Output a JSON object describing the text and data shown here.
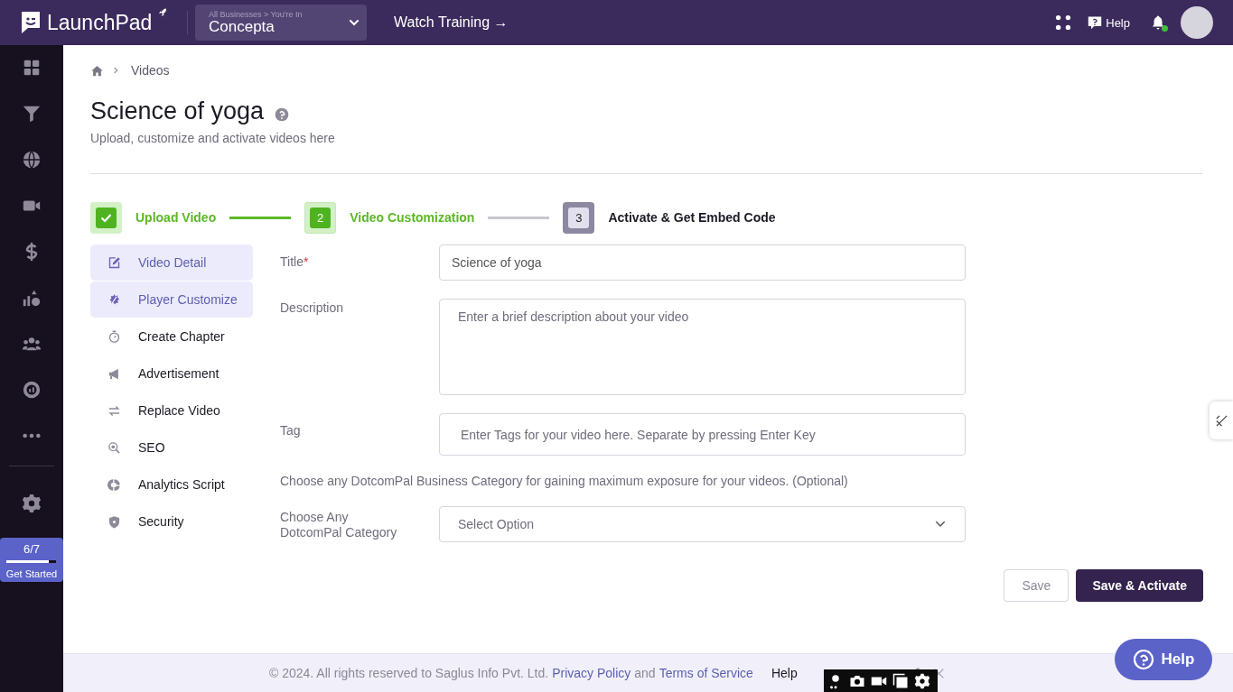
{
  "topbar": {
    "logo": "LaunchPad",
    "business_switcher": {
      "caption": "All Businesses > You're In",
      "value": "Concepta"
    },
    "training_link": "Watch Training →",
    "help": "Help",
    "notification_unread": true
  },
  "sidebar": {
    "items": [
      {
        "kind": "grid"
      },
      {
        "kind": "funnel"
      },
      {
        "kind": "globe"
      },
      {
        "kind": "video"
      },
      {
        "kind": "dollar"
      },
      {
        "kind": "chart"
      },
      {
        "kind": "users"
      },
      {
        "kind": "gauge"
      },
      {
        "kind": "more"
      }
    ],
    "progress": {
      "count": "6/7",
      "level": 0.85,
      "label": "Get Started"
    }
  },
  "breadcrumb": [
    "Videos"
  ],
  "page": {
    "title": "Science of yoga",
    "subtitle": "Upload, customize and activate videos here"
  },
  "steps": [
    {
      "label": "Upload Video",
      "completed": true,
      "selected": false
    },
    {
      "number": "2",
      "label": "Video Customization",
      "completed": false,
      "selected": true
    },
    {
      "number": "3",
      "label": "Activate & Get Embed Code",
      "completed": false,
      "selected": false
    }
  ],
  "menu": [
    {
      "kind": "edit",
      "label": "Video Detail",
      "highlighted": true
    },
    {
      "kind": "puzzle",
      "label": "Player Customize",
      "highlighted": true
    },
    {
      "kind": "timer",
      "label": "Create Chapter",
      "highlighted": false
    },
    {
      "kind": "megaphone",
      "label": "Advertisement",
      "highlighted": false
    },
    {
      "kind": "swap",
      "label": "Replace Video",
      "highlighted": false
    },
    {
      "kind": "search",
      "label": "SEO",
      "highlighted": false
    },
    {
      "kind": "pie",
      "label": "Analytics Script",
      "highlighted": false
    },
    {
      "kind": "shield",
      "label": "Security",
      "highlighted": false
    }
  ],
  "form": [
    {
      "kind": "text",
      "label": "Title",
      "required_mark": "*",
      "value": "Science of yoga"
    },
    {
      "kind": "textarea",
      "label": "Description",
      "placeholder": "Enter a brief description about your video"
    },
    {
      "kind": "tag",
      "label": "Tag",
      "placeholder": "Enter Tags for your video here. Separate by pressing Enter Key"
    },
    {
      "kind": "note",
      "text": "Choose any DotcomPal Business Category for gaining maximum exposure for your videos. (Optional)"
    },
    {
      "kind": "select",
      "label": "Choose Any DotcomPal Category",
      "placeholder": "Select Option"
    }
  ],
  "buttons": [
    {
      "label": "Save",
      "primary": false
    },
    {
      "label": "Save & Activate",
      "primary": true
    }
  ],
  "footer": {
    "copyright": "©  2024. All rights reserved to Saglus Info Pvt. Ltd.",
    "privacy": "Privacy Policy",
    "and": "and",
    "terms": "Terms of Service",
    "links": [
      "Help"
    ]
  },
  "help_button": "Help"
}
